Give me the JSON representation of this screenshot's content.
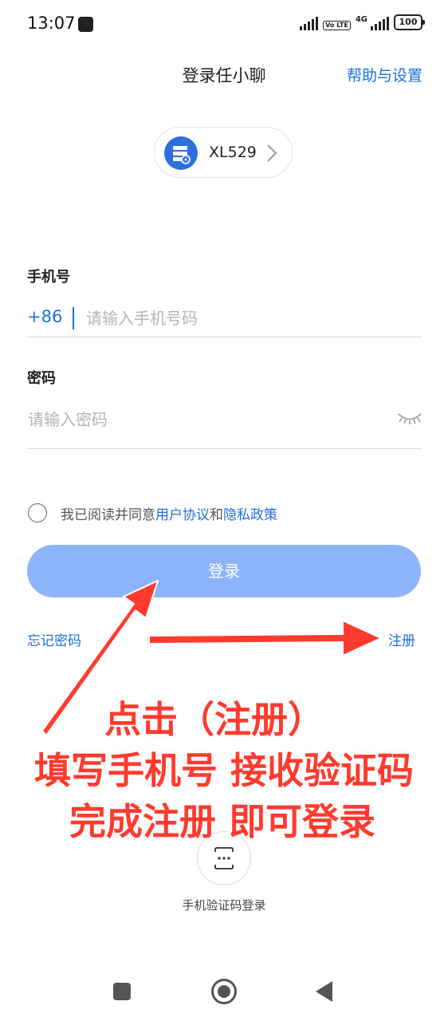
{
  "status_bar": {
    "time": "13:07",
    "volte_label": "Vo LTE",
    "network_label": "4G",
    "battery": "100"
  },
  "header": {
    "title": "登录任小聊",
    "help_link": "帮助与设置"
  },
  "server": {
    "name": "XL529",
    "icon": "server-icon"
  },
  "form": {
    "phone_label": "手机号",
    "country_code": "+86",
    "phone_placeholder": "请输入手机号码",
    "phone_value": "",
    "password_label": "密码",
    "password_placeholder": "请输入密码",
    "password_value": ""
  },
  "agreement": {
    "prefix": "我已阅读并同意",
    "user_agreement": "用户协议",
    "conjunction": "和",
    "privacy_policy": "隐私政策",
    "checked": false
  },
  "actions": {
    "login": "登录",
    "forgot_password": "忘记密码",
    "register": "注册"
  },
  "annotation": {
    "line1": "点击（注册）",
    "line2": "填写手机号 接收验证码",
    "line3": "完成注册  即可登录"
  },
  "sms_login": {
    "label": "手机验证码登录"
  },
  "colors": {
    "accent": "#1e6fd9",
    "login_button": "#8db4fb",
    "annotation_red": "#ff3a2e",
    "server_icon_bg": "#2d6fe0"
  }
}
